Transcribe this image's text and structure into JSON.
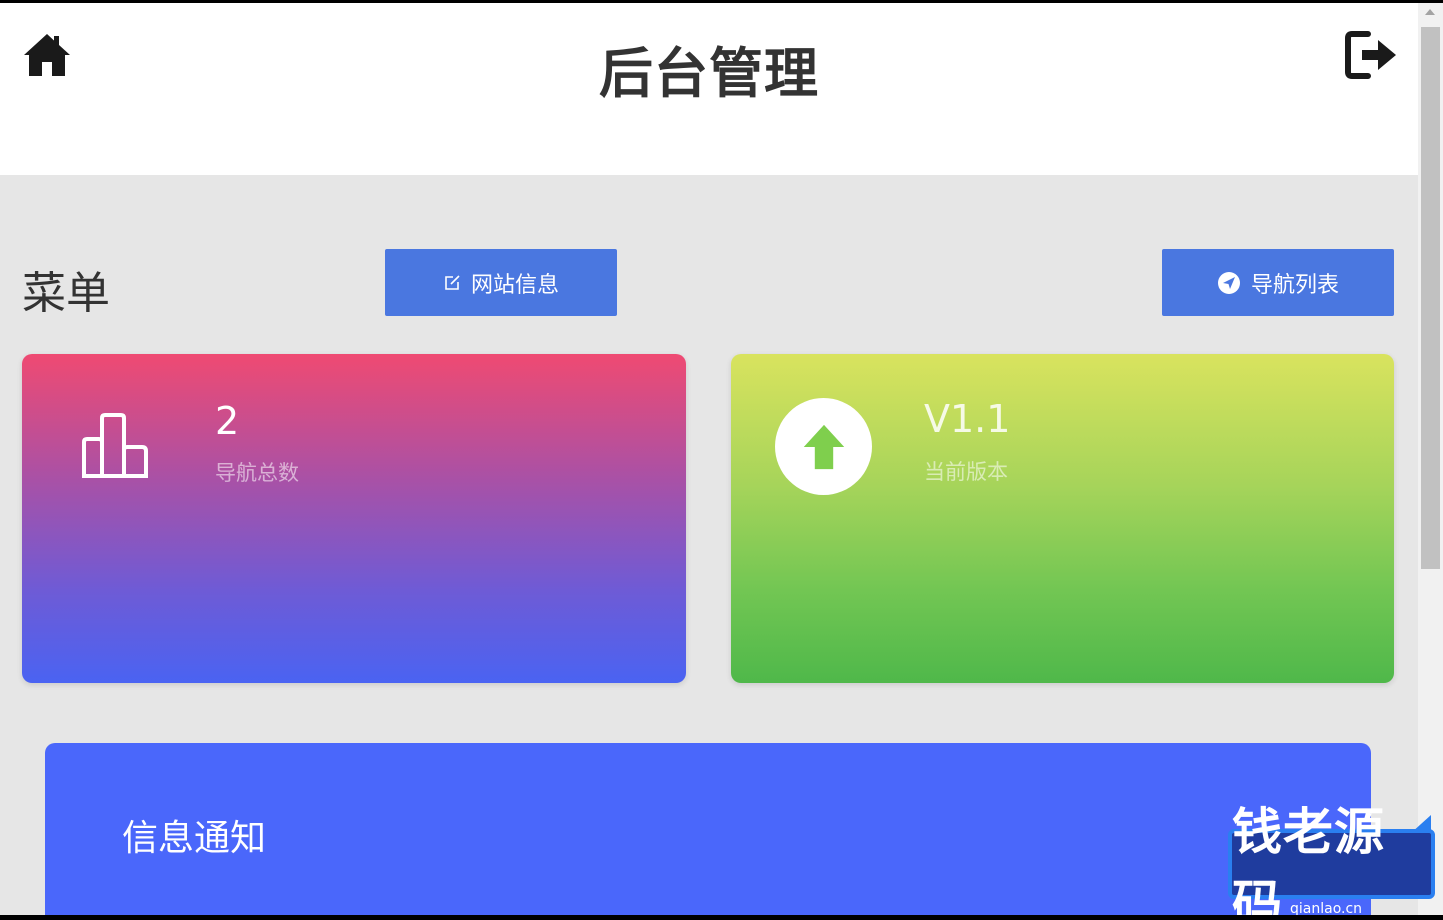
{
  "header": {
    "title": "后台管理",
    "home_icon": "home-icon",
    "logout_icon": "logout-icon"
  },
  "menu": {
    "label": "菜单",
    "buttons": [
      {
        "label": "网站信息",
        "icon": "edit-icon"
      },
      {
        "label": "导航列表",
        "icon": "navigation-arrow-icon"
      }
    ]
  },
  "stats": [
    {
      "value": "2",
      "label": "导航总数",
      "icon": "bar-chart-icon",
      "colors": [
        "#ef4a72",
        "#4a63f2"
      ]
    },
    {
      "value": "V1.1",
      "label": "当前版本",
      "icon": "up-arrow-icon",
      "colors": [
        "#d9e35e",
        "#4fb84a"
      ]
    }
  ],
  "notice": {
    "title": "信息通知",
    "color": "#4a67fb"
  },
  "watermark": {
    "text": "钱老源码",
    "domain": "qianlao.cn"
  },
  "colors": {
    "accent_button": "#4a77e0",
    "page_background": "#e6e6e6"
  }
}
